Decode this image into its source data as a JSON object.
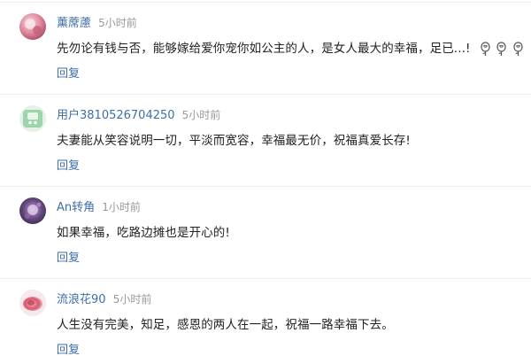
{
  "comments": [
    {
      "username": "薰蓆藘",
      "time": "5小时前",
      "text": "先勿论有钱与否，能够嫁给爱你宠你如公主的人，是女人最大的幸福，足已...!",
      "reply": "回复",
      "emoji_icons": [
        "rose-emoji-icon",
        "rose-emoji-icon",
        "rose-emoji-icon"
      ]
    },
    {
      "username": "用户3810526704250",
      "time": "5小时前",
      "text": "夫妻能从笑容说明一切，平淡而宽容，幸福最无价，祝福真爱长存!",
      "reply": "回复"
    },
    {
      "username": "An转角",
      "time": "1小时前",
      "text": "如果幸福，吃路边摊也是开心的!",
      "reply": "回复"
    },
    {
      "username": "流浪花90",
      "time": "5小时前",
      "text": "人生没有完美，知足，感恩的两人在一起，祝福一路幸福下去。",
      "reply": "回复"
    }
  ],
  "colors": {
    "username": "#3d6ea8",
    "time": "#999999",
    "text": "#222222",
    "reply": "#3d6ea8",
    "divider": "#ececec"
  }
}
